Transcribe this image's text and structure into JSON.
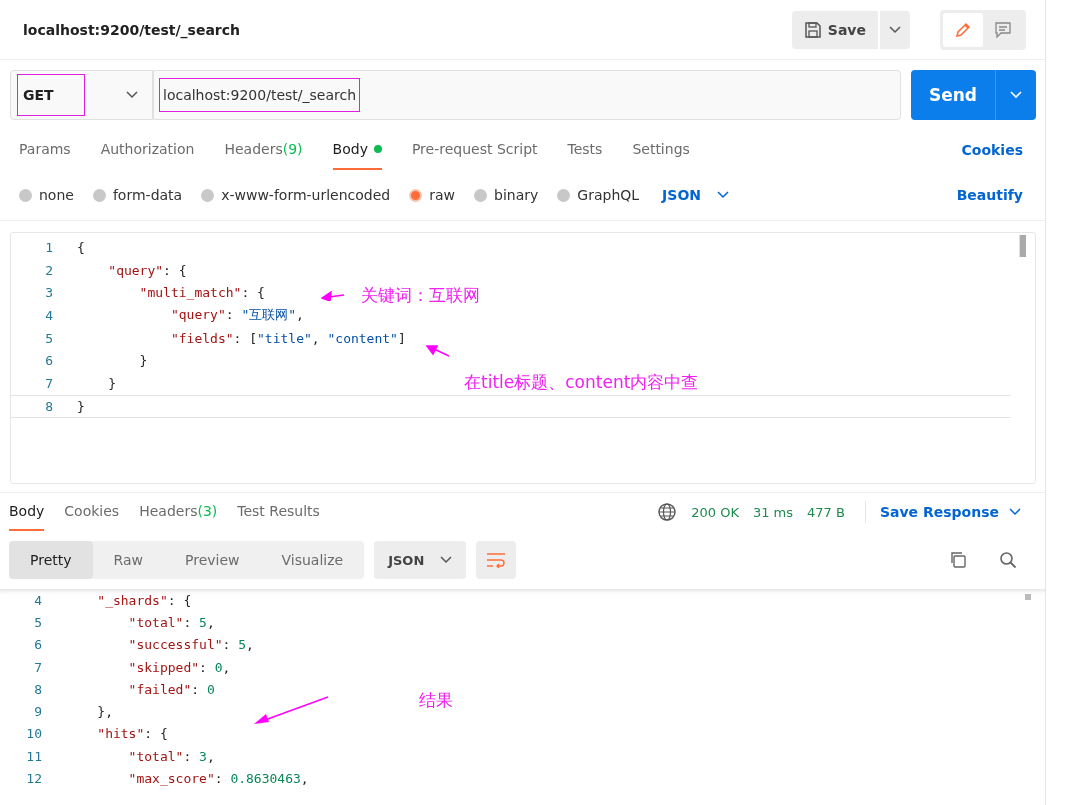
{
  "header": {
    "title": "localhost:9200/test/_search",
    "save": "Save",
    "modes": [
      {
        "kind": "edit",
        "selected": true
      },
      {
        "kind": "comments",
        "selected": false
      }
    ]
  },
  "request": {
    "method": "GET",
    "url": "localhost:9200/test/_search",
    "send": "Send"
  },
  "request_tabs": [
    {
      "label": "Params",
      "selected": false
    },
    {
      "label": "Authorization",
      "selected": false
    },
    {
      "label": "Headers",
      "count": "(9)",
      "selected": false
    },
    {
      "label": "Body",
      "selected": true,
      "dot": true
    },
    {
      "label": "Pre-request Script",
      "selected": false
    },
    {
      "label": "Tests",
      "selected": false
    },
    {
      "label": "Settings",
      "selected": false
    }
  ],
  "cookies_link": "Cookies",
  "body_types": [
    {
      "label": "none",
      "selected": false
    },
    {
      "label": "form-data",
      "selected": false
    },
    {
      "label": "x-www-form-urlencoded",
      "selected": false
    },
    {
      "label": "raw",
      "selected": true
    },
    {
      "label": "binary",
      "selected": false
    },
    {
      "label": "GraphQL",
      "selected": false
    }
  ],
  "body_format": "JSON",
  "beautify": "Beautify",
  "editor_lines": [
    {
      "number": "1",
      "tokens": [
        {
          "kind": "punct",
          "text": "{"
        }
      ]
    },
    {
      "number": "2",
      "tokens": [
        {
          "kind": "key",
          "text": "    \"query\""
        },
        {
          "kind": "punct",
          "text": ": {"
        }
      ]
    },
    {
      "number": "3",
      "tokens": [
        {
          "kind": "key",
          "text": "        \"multi_match\""
        },
        {
          "kind": "punct",
          "text": ": {"
        }
      ]
    },
    {
      "number": "4",
      "tokens": [
        {
          "kind": "key",
          "text": "            \"query\""
        },
        {
          "kind": "punct",
          "text": ": "
        },
        {
          "kind": "str",
          "text": "\"互联网\""
        },
        {
          "kind": "punct",
          "text": ","
        }
      ]
    },
    {
      "number": "5",
      "tokens": [
        {
          "kind": "key",
          "text": "            \"fields\""
        },
        {
          "kind": "punct",
          "text": ": ["
        },
        {
          "kind": "str",
          "text": "\"title\""
        },
        {
          "kind": "punct",
          "text": ", "
        },
        {
          "kind": "str",
          "text": "\"content\""
        },
        {
          "kind": "punct",
          "text": "]"
        }
      ]
    },
    {
      "number": "6",
      "tokens": [
        {
          "kind": "punct",
          "text": "        }"
        }
      ]
    },
    {
      "number": "7",
      "tokens": [
        {
          "kind": "punct",
          "text": "    }"
        }
      ]
    },
    {
      "number": "8",
      "current": true,
      "tokens": [
        {
          "kind": "punct",
          "text": "}"
        }
      ]
    }
  ],
  "annotations": [
    {
      "text": "关键词：互联网"
    },
    {
      "text": "在title标题、content内容中查"
    },
    {
      "text": "结果"
    }
  ],
  "response_tabs": [
    {
      "label": "Body",
      "selected": true
    },
    {
      "label": "Cookies",
      "selected": false
    },
    {
      "label": "Headers",
      "count": "(3)",
      "selected": false
    },
    {
      "label": "Test Results",
      "selected": false
    }
  ],
  "status": {
    "code": "200 OK",
    "time": "31 ms",
    "size": "477 B"
  },
  "save_response": "Save Response",
  "view_modes": [
    {
      "label": "Pretty",
      "selected": true
    },
    {
      "label": "Raw",
      "selected": false
    },
    {
      "label": "Preview",
      "selected": false
    },
    {
      "label": "Visualize",
      "selected": false
    }
  ],
  "response_format": "JSON",
  "response_lines": [
    {
      "number": "4",
      "tokens": [
        {
          "kind": "key",
          "text": "    \"_shards\""
        },
        {
          "kind": "punct",
          "text": ": {"
        }
      ]
    },
    {
      "number": "5",
      "tokens": [
        {
          "kind": "key",
          "text": "        \"total\""
        },
        {
          "kind": "punct",
          "text": ": "
        },
        {
          "kind": "num",
          "text": "5"
        },
        {
          "kind": "punct",
          "text": ","
        }
      ]
    },
    {
      "number": "6",
      "tokens": [
        {
          "kind": "key",
          "text": "        \"successful\""
        },
        {
          "kind": "punct",
          "text": ": "
        },
        {
          "kind": "num",
          "text": "5"
        },
        {
          "kind": "punct",
          "text": ","
        }
      ]
    },
    {
      "number": "7",
      "tokens": [
        {
          "kind": "key",
          "text": "        \"skipped\""
        },
        {
          "kind": "punct",
          "text": ": "
        },
        {
          "kind": "num",
          "text": "0"
        },
        {
          "kind": "punct",
          "text": ","
        }
      ]
    },
    {
      "number": "8",
      "tokens": [
        {
          "kind": "key",
          "text": "        \"failed\""
        },
        {
          "kind": "punct",
          "text": ": "
        },
        {
          "kind": "num",
          "text": "0"
        }
      ]
    },
    {
      "number": "9",
      "tokens": [
        {
          "kind": "punct",
          "text": "    },"
        }
      ]
    },
    {
      "number": "10",
      "tokens": [
        {
          "kind": "key",
          "text": "    \"hits\""
        },
        {
          "kind": "punct",
          "text": ": {"
        }
      ]
    },
    {
      "number": "11",
      "tokens": [
        {
          "kind": "key",
          "text": "        \"total\""
        },
        {
          "kind": "punct",
          "text": ": "
        },
        {
          "kind": "num",
          "text": "3"
        },
        {
          "kind": "punct",
          "text": ","
        }
      ]
    },
    {
      "number": "12",
      "tokens": [
        {
          "kind": "key",
          "text": "        \"max_score\""
        },
        {
          "kind": "punct",
          "text": ": "
        },
        {
          "kind": "num",
          "text": "0.8630463"
        },
        {
          "kind": "punct",
          "text": ","
        }
      ]
    }
  ]
}
